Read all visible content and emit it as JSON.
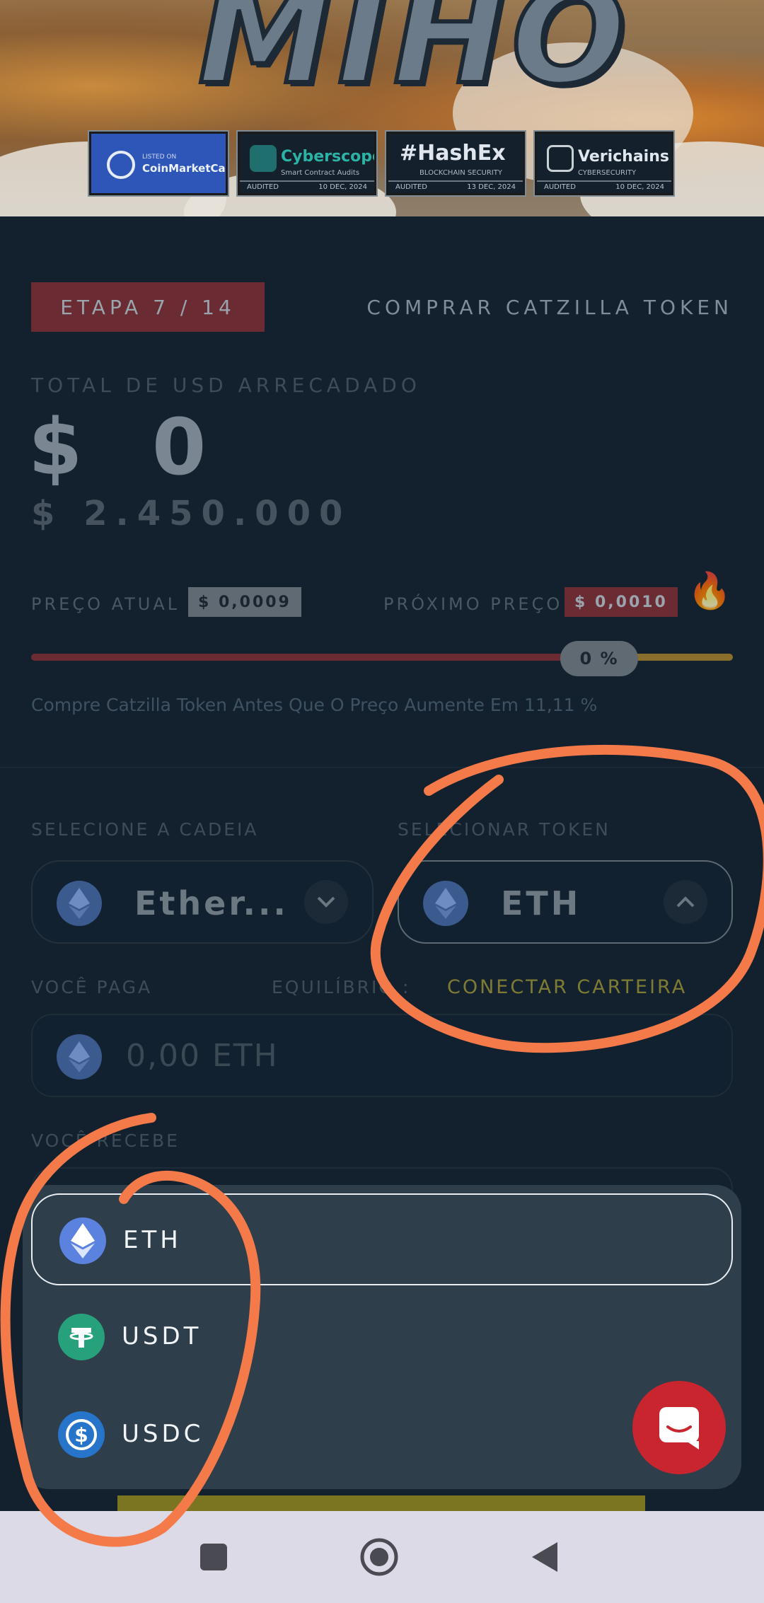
{
  "hero": {
    "title": "MIHO",
    "badges": [
      {
        "top": "LISTED ON",
        "name": "CoinMarketCap",
        "sub": "",
        "foot_left": "",
        "foot_right": ""
      },
      {
        "name": "Cyberscope",
        "sub": "Smart Contract Audits",
        "foot_left": "AUDITED",
        "foot_right": "10 DEC, 2024"
      },
      {
        "name": "#HashEx",
        "sub": "BLOCKCHAIN SECURITY",
        "foot_left": "AUDITED",
        "foot_right": "13 DEC, 2024"
      },
      {
        "name": "Verichains",
        "sub": "CYBERSECURITY",
        "foot_left": "AUDITED",
        "foot_right": "10 DEC, 2024"
      }
    ]
  },
  "presale": {
    "stage": "ETAPA 7 / 14",
    "title": "COMPRAR CATZILLA TOKEN",
    "raised_label": "TOTAL DE USD ARRECADADO",
    "raised_value": "$ 0",
    "goal_value": "$ 2.450.000",
    "current_price_label": "PREÇO ATUAL",
    "current_price": "$ 0,0009",
    "next_price_label": "PRÓXIMO PREÇO",
    "next_price": "$ 0,0010",
    "progress_percent": 0,
    "progress_label": "0 %",
    "note": "Compre Catzilla Token Antes Que O Preço Aumente Em 11,11 %"
  },
  "form": {
    "chain_label": "SELECIONE A CADEIA",
    "chain_value": "Ether...",
    "token_label": "SELECIONAR TOKEN",
    "token_value": "ETH",
    "pay_label": "VOCÊ PAGA",
    "balance_label": "EQUILÍBRIO :",
    "connect_label": "CONECTAR CARTEIRA",
    "pay_placeholder": "0,00 ETH",
    "receive_label": "VOCÊ RECEBE"
  },
  "dropdown": {
    "options": [
      {
        "label": "ETH",
        "icon": "eth-icon",
        "selected": true
      },
      {
        "label": "USDT",
        "icon": "usdt-icon",
        "selected": false
      },
      {
        "label": "USDC",
        "icon": "usdc-icon",
        "selected": false
      }
    ]
  },
  "colors": {
    "background": "#122130",
    "accent_red": "#c8252e",
    "annotation_orange": "#f47a4a",
    "connect_yellow": "#7f7b33"
  }
}
